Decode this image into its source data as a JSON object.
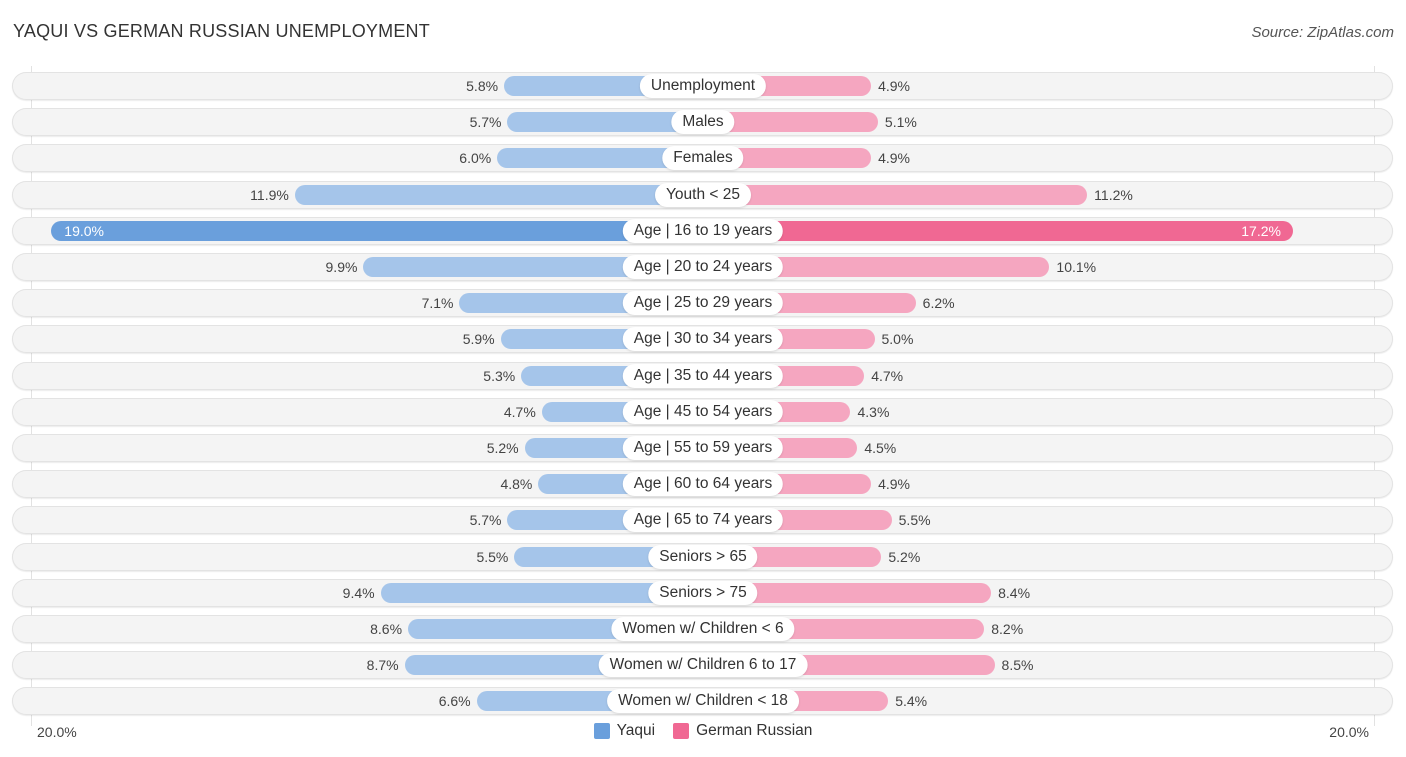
{
  "chart_data": {
    "type": "bar",
    "orientation": "horizontal-diverging",
    "title": "YAQUI VS GERMAN RUSSIAN UNEMPLOYMENT",
    "source": "Source: ZipAtlas.com",
    "categories": [
      "Unemployment",
      "Males",
      "Females",
      "Youth < 25",
      "Age | 16 to 19 years",
      "Age | 20 to 24 years",
      "Age | 25 to 29 years",
      "Age | 30 to 34 years",
      "Age | 35 to 44 years",
      "Age | 45 to 54 years",
      "Age | 55 to 59 years",
      "Age | 60 to 64 years",
      "Age | 65 to 74 years",
      "Seniors > 65",
      "Seniors > 75",
      "Women w/ Children < 6",
      "Women w/ Children 6 to 17",
      "Women w/ Children < 18"
    ],
    "series": [
      {
        "name": "Yaqui",
        "side": "left",
        "color": "#a5c5ea",
        "highlight_color": "#6a9fdc",
        "values": [
          5.8,
          5.7,
          6.0,
          11.9,
          19.0,
          9.9,
          7.1,
          5.9,
          5.3,
          4.7,
          5.2,
          4.8,
          5.7,
          5.5,
          9.4,
          8.6,
          8.7,
          6.6
        ],
        "labels": [
          "5.8%",
          "5.7%",
          "6.0%",
          "11.9%",
          "19.0%",
          "9.9%",
          "7.1%",
          "5.9%",
          "5.3%",
          "4.7%",
          "5.2%",
          "4.8%",
          "5.7%",
          "5.5%",
          "9.4%",
          "8.6%",
          "8.7%",
          "6.6%"
        ]
      },
      {
        "name": "German Russian",
        "side": "right",
        "color": "#f5a6c0",
        "highlight_color": "#f06893",
        "values": [
          4.9,
          5.1,
          4.9,
          11.2,
          17.2,
          10.1,
          6.2,
          5.0,
          4.7,
          4.3,
          4.5,
          4.9,
          5.5,
          5.2,
          8.4,
          8.2,
          8.5,
          5.4
        ],
        "labels": [
          "4.9%",
          "5.1%",
          "4.9%",
          "11.2%",
          "17.2%",
          "10.1%",
          "6.2%",
          "5.0%",
          "4.7%",
          "4.3%",
          "4.5%",
          "4.9%",
          "5.5%",
          "5.2%",
          "8.4%",
          "8.2%",
          "8.5%",
          "5.4%"
        ]
      }
    ],
    "highlight_index": 4,
    "xlim": [
      0,
      20
    ],
    "axis_labels": {
      "left": "20.0%",
      "right": "20.0%"
    },
    "legend": [
      {
        "name": "Yaqui",
        "color": "#6a9fdc"
      },
      {
        "name": "German Russian",
        "color": "#f06893"
      }
    ],
    "legend_position": "bottom-center",
    "grid": false
  }
}
